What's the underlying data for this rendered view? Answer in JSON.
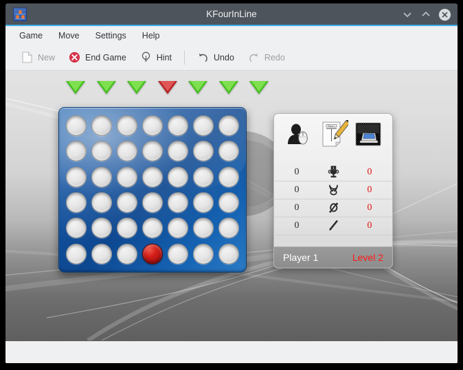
{
  "window": {
    "title": "KFourInLine",
    "app_icon": "kfourinline-app-icon",
    "controls": {
      "minimize": "minimize-icon",
      "maximize": "maximize-icon",
      "close": "close-icon"
    }
  },
  "menubar": {
    "items": [
      {
        "label": "Game"
      },
      {
        "label": "Move"
      },
      {
        "label": "Settings"
      },
      {
        "label": "Help"
      }
    ]
  },
  "toolbar": {
    "buttons": [
      {
        "label": "New",
        "icon": "new-document-icon",
        "enabled": false
      },
      {
        "label": "End Game",
        "icon": "end-game-icon",
        "enabled": true
      },
      {
        "label": "Hint",
        "icon": "lightbulb-icon",
        "enabled": true
      },
      {
        "label": "Undo",
        "icon": "undo-arrow-icon",
        "enabled": true
      },
      {
        "label": "Redo",
        "icon": "redo-arrow-icon",
        "enabled": false
      }
    ]
  },
  "game": {
    "columns": 7,
    "rows": 6,
    "drop_arrows": [
      {
        "column": 1,
        "state": "normal",
        "color": "#46c020"
      },
      {
        "column": 2,
        "state": "normal",
        "color": "#46c020"
      },
      {
        "column": 3,
        "state": "normal",
        "color": "#46c020"
      },
      {
        "column": 4,
        "state": "highlight",
        "color": "#b92323"
      },
      {
        "column": 5,
        "state": "normal",
        "color": "#46c020"
      },
      {
        "column": 6,
        "state": "normal",
        "color": "#46c020"
      },
      {
        "column": 7,
        "state": "normal",
        "color": "#46c020"
      }
    ],
    "board": [
      [
        "empty",
        "empty",
        "empty",
        "empty",
        "empty",
        "empty",
        "empty"
      ],
      [
        "empty",
        "empty",
        "empty",
        "empty",
        "empty",
        "empty",
        "empty"
      ],
      [
        "empty",
        "empty",
        "empty",
        "empty",
        "empty",
        "empty",
        "empty"
      ],
      [
        "empty",
        "empty",
        "empty",
        "empty",
        "empty",
        "empty",
        "empty"
      ],
      [
        "empty",
        "empty",
        "empty",
        "empty",
        "empty",
        "empty",
        "empty"
      ],
      [
        "empty",
        "empty",
        "empty",
        "red",
        "empty",
        "empty",
        "empty"
      ]
    ],
    "board_color": "#14529e",
    "piece_red": "#d4201a"
  },
  "score_panel": {
    "header_icons": [
      {
        "name": "human-player-icon",
        "title": "Human player"
      },
      {
        "name": "scoresheet-pencil-icon",
        "title": "Player 1"
      },
      {
        "name": "computer-player-icon",
        "title": "Computer"
      }
    ],
    "scoresheet_label": "Player 1",
    "rows": [
      {
        "icon": "trophy-icon",
        "left": "0",
        "right": "0"
      },
      {
        "icon": "draw-icon",
        "left": "0",
        "right": "0"
      },
      {
        "icon": "loss-icon",
        "left": "0",
        "right": "0"
      },
      {
        "icon": "break-icon",
        "left": "0",
        "right": "0"
      }
    ],
    "footer": {
      "player": "Player 1",
      "level": "Level 2"
    },
    "left_value_color": "#2b2b2b",
    "right_value_color": "#e0120f",
    "level_color": "#ff1a13"
  },
  "statusbar": {
    "text": ""
  }
}
